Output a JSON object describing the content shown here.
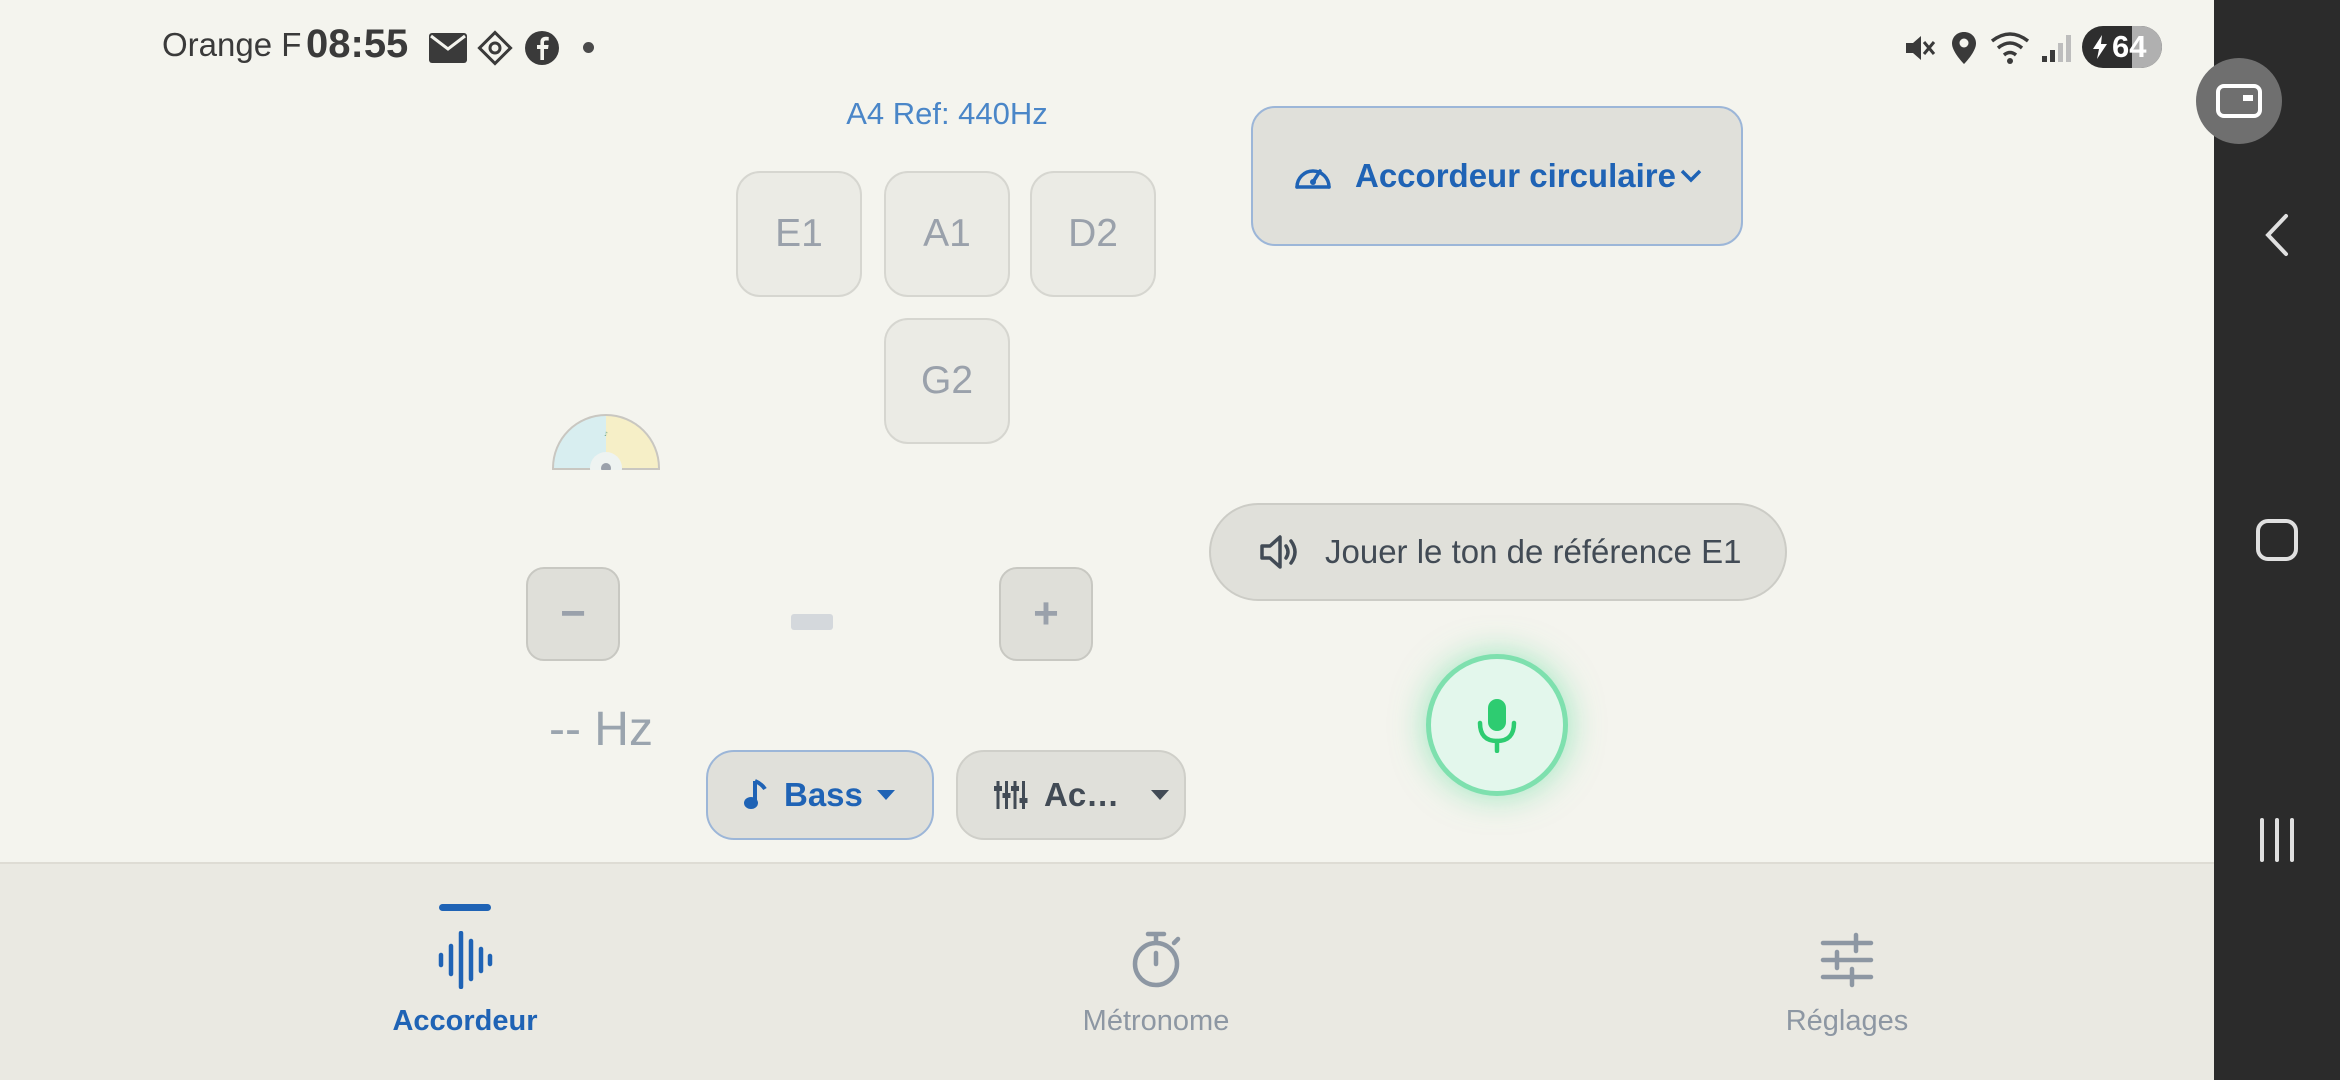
{
  "status_bar": {
    "carrier": "Orange F",
    "time": "08:55",
    "notification_icons": [
      "mail-icon",
      "sync-icon",
      "facebook-icon"
    ],
    "system_icons": [
      "mute-icon",
      "location-icon",
      "wifi-icon",
      "signal-icon"
    ],
    "battery_level": "64"
  },
  "tuner": {
    "reference": "A4 Ref: 440Hz",
    "strings": [
      "E1",
      "A1",
      "D2",
      "G2"
    ],
    "mode_dropdown": "Accordeur circulaire",
    "decrease_label": "−",
    "increase_label": "+",
    "frequency": "-- Hz",
    "play_reference_label": "Jouer le ton de référence E1",
    "instrument": "Bass",
    "tuning": "Ac…"
  },
  "bottom_nav": {
    "items": [
      {
        "label": "Accordeur",
        "icon": "waveform-icon",
        "active": true
      },
      {
        "label": "Métronome",
        "icon": "stopwatch-icon",
        "active": false
      },
      {
        "label": "Réglages",
        "icon": "sliders-icon",
        "active": false
      }
    ]
  },
  "colors": {
    "accent": "#1f63b5",
    "background": "#f4f4ee",
    "mic_green": "#2ecc71",
    "muted_text": "#9aa1ab",
    "nav_bar": "#eae9e2",
    "system_bar": "#2b2b2b"
  }
}
